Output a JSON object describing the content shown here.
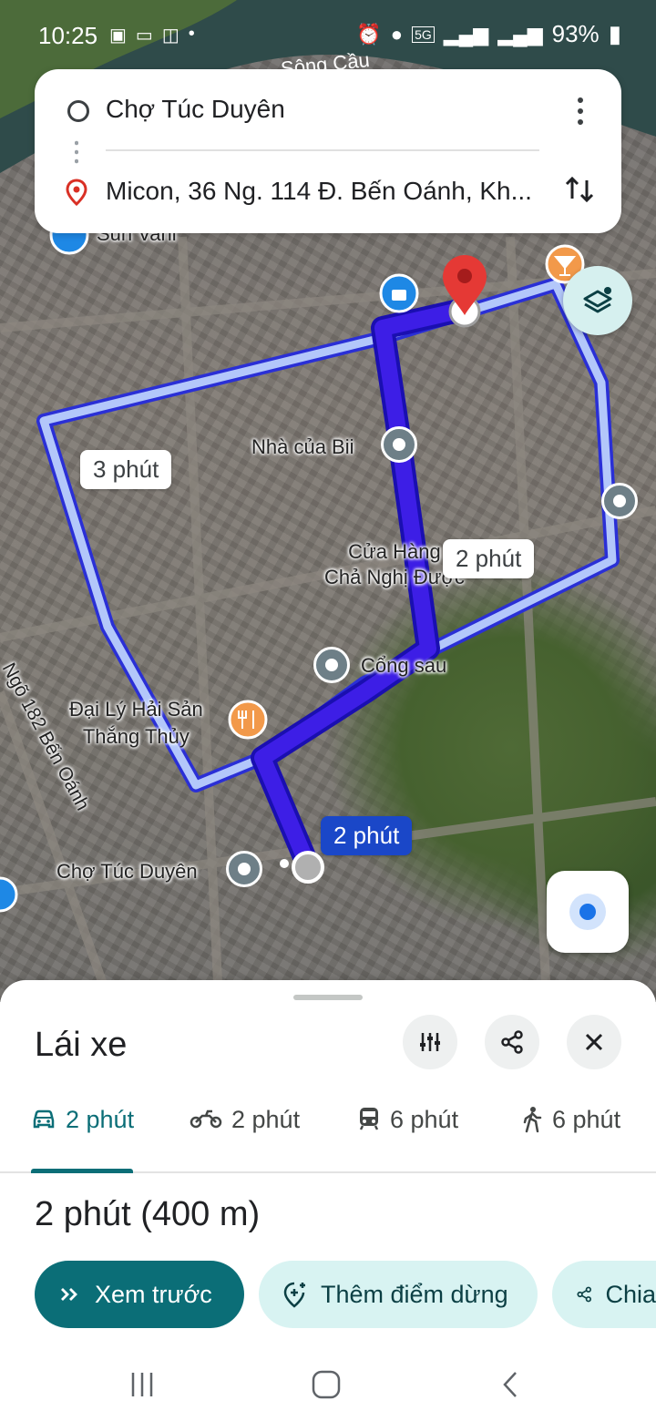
{
  "status_bar": {
    "time": "10:25",
    "notification_icons": [
      "gallery-icon",
      "zalo-icon",
      "voicemail-icon",
      "dot-icon"
    ],
    "network": "5G",
    "battery": "93%"
  },
  "directions": {
    "origin": "Chợ Túc Duyên",
    "destination": "Micon, 36 Ng. 114 Đ. Bến Oánh, Kh..."
  },
  "map": {
    "labels": {
      "top_left": "Sun Vani",
      "river": "Sông Cầu",
      "nha_cua_bii": "Nhà của Bii",
      "cua_hang": "Cửa Hàng\nChả Nghị Được",
      "cong_sau": "Cổng sau",
      "dai_ly": "Đại Lý Hải Sản\nThắng Thủy",
      "cho_tuc_duyen": "Chợ Túc Duyên",
      "street": "Ngõ 182 Bến Oánh"
    },
    "route_times": {
      "alt_left": "3 phút",
      "alt_right": "2 phút",
      "primary": "2 phút"
    },
    "colors": {
      "route_primary": "#3d1ee6",
      "route_alt": "#b3c7fa",
      "destination_pin": "#e53935"
    }
  },
  "sheet": {
    "title": "Lái xe",
    "modes": [
      {
        "icon": "car-icon",
        "label": "2 phút",
        "active": true
      },
      {
        "icon": "motorbike-icon",
        "label": "2 phút"
      },
      {
        "icon": "transit-icon",
        "label": "6 phút"
      },
      {
        "icon": "walk-icon",
        "label": "6 phút"
      }
    ],
    "summary": "2 phút (400 m)",
    "buttons": {
      "preview": "Xem trước",
      "add_stop": "Thêm điểm dừng",
      "share": "Chia"
    }
  }
}
